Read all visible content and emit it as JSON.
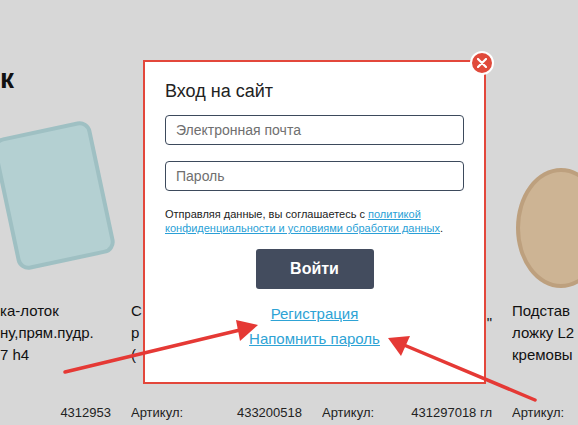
{
  "page": {
    "heading": "к"
  },
  "products": [
    {
      "has_image": true,
      "title_lines": [
        "ка-лоток",
        "ну,прям.пудр.",
        "7 h4"
      ],
      "article": "4312953"
    },
    {
      "has_image": false,
      "title_lines": [
        "С",
        "р",
        "("
      ],
      "article_label": "Артикул:",
      "article": "433200518"
    },
    {
      "has_image": false,
      "title_lines": [
        "\""
      ],
      "article_label": "Артикул:",
      "article": "431297018 гл"
    },
    {
      "has_image": true,
      "title_lines": [
        "Подстав",
        "ложку L2",
        "кремовы"
      ],
      "article_label": "Артикул:"
    }
  ],
  "modal": {
    "title": "Вход на сайт",
    "fields": [
      {
        "placeholder": "Электронная почта",
        "kind": "email"
      },
      {
        "placeholder": "Пароль",
        "kind": "password"
      }
    ],
    "consent": {
      "text": "Отправляя данные, вы соглашаетесь с ",
      "link": "политикой конфиденциальности и условиями обработки данных",
      "end": "."
    },
    "submit": "Войти",
    "links": [
      {
        "label": "Регистрация"
      },
      {
        "label": "Напомнить пароль"
      }
    ]
  }
}
